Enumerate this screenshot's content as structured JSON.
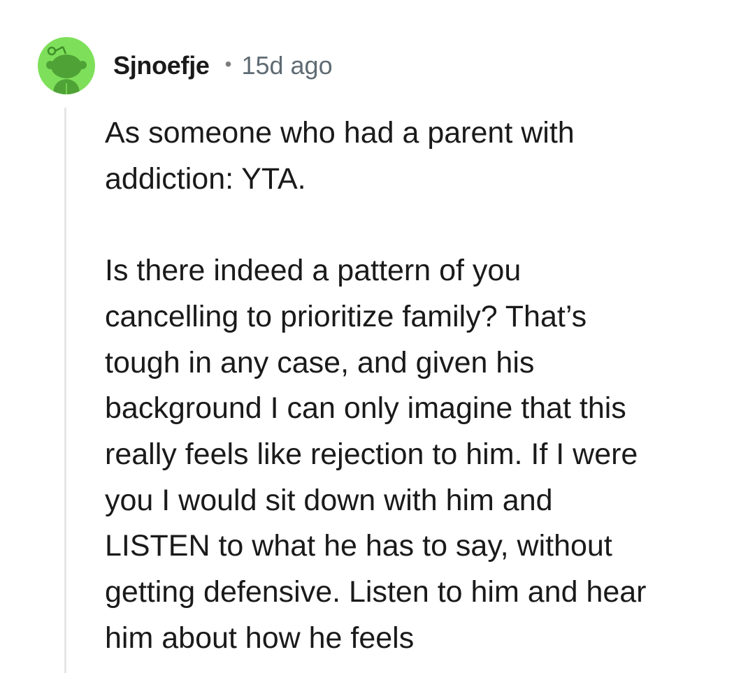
{
  "comment": {
    "author": "Sjnoefje",
    "separator": "•",
    "timestamp": "15d ago",
    "avatar_icon": "snoo-avatar-icon",
    "avatar_color": "#7ee05a",
    "body_lines": [
      "As someone who had a parent with",
      "addiction: YTA.",
      "",
      "Is there indeed a pattern of you",
      "cancelling to prioritize family? That’s",
      "tough in any case, and given his",
      "background I can only imagine that this",
      "really feels like rejection to him. If I were",
      "you I would sit down with him and",
      "LISTEN to what he has to say, without",
      "getting defensive. Listen to him and hear",
      "him about how he feels"
    ]
  }
}
